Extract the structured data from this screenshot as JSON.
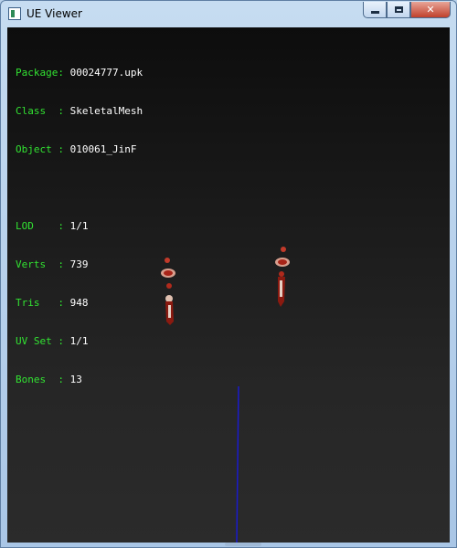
{
  "window": {
    "title": "UE Viewer",
    "controls": {
      "minimize_icon": "minimize-icon",
      "maximize_icon": "maximize-icon",
      "close_icon": "close-icon",
      "close_glyph": "✕"
    }
  },
  "info": {
    "package": {
      "label": "Package",
      "sep": ":",
      "value": "00024777.upk"
    },
    "class": {
      "label": "Class  ",
      "sep": ":",
      "value": "SkeletalMesh"
    },
    "object": {
      "label": "Object ",
      "sep": ":",
      "value": "010061_JinF"
    },
    "lod": {
      "label": "LOD    ",
      "sep": ":",
      "value": "1/1"
    },
    "verts": {
      "label": "Verts  ",
      "sep": ":",
      "value": "739"
    },
    "tris": {
      "label": "Tris   ",
      "sep": ":",
      "value": "948"
    },
    "uvset": {
      "label": "UV Set ",
      "sep": ":",
      "value": "1/1"
    },
    "bones": {
      "label": "Bones  ",
      "sep": ":",
      "value": "13"
    }
  },
  "colors": {
    "label": "#32e332",
    "value": "#ffffff",
    "axis": "#1a1acc",
    "mesh": "#c23a2a"
  }
}
